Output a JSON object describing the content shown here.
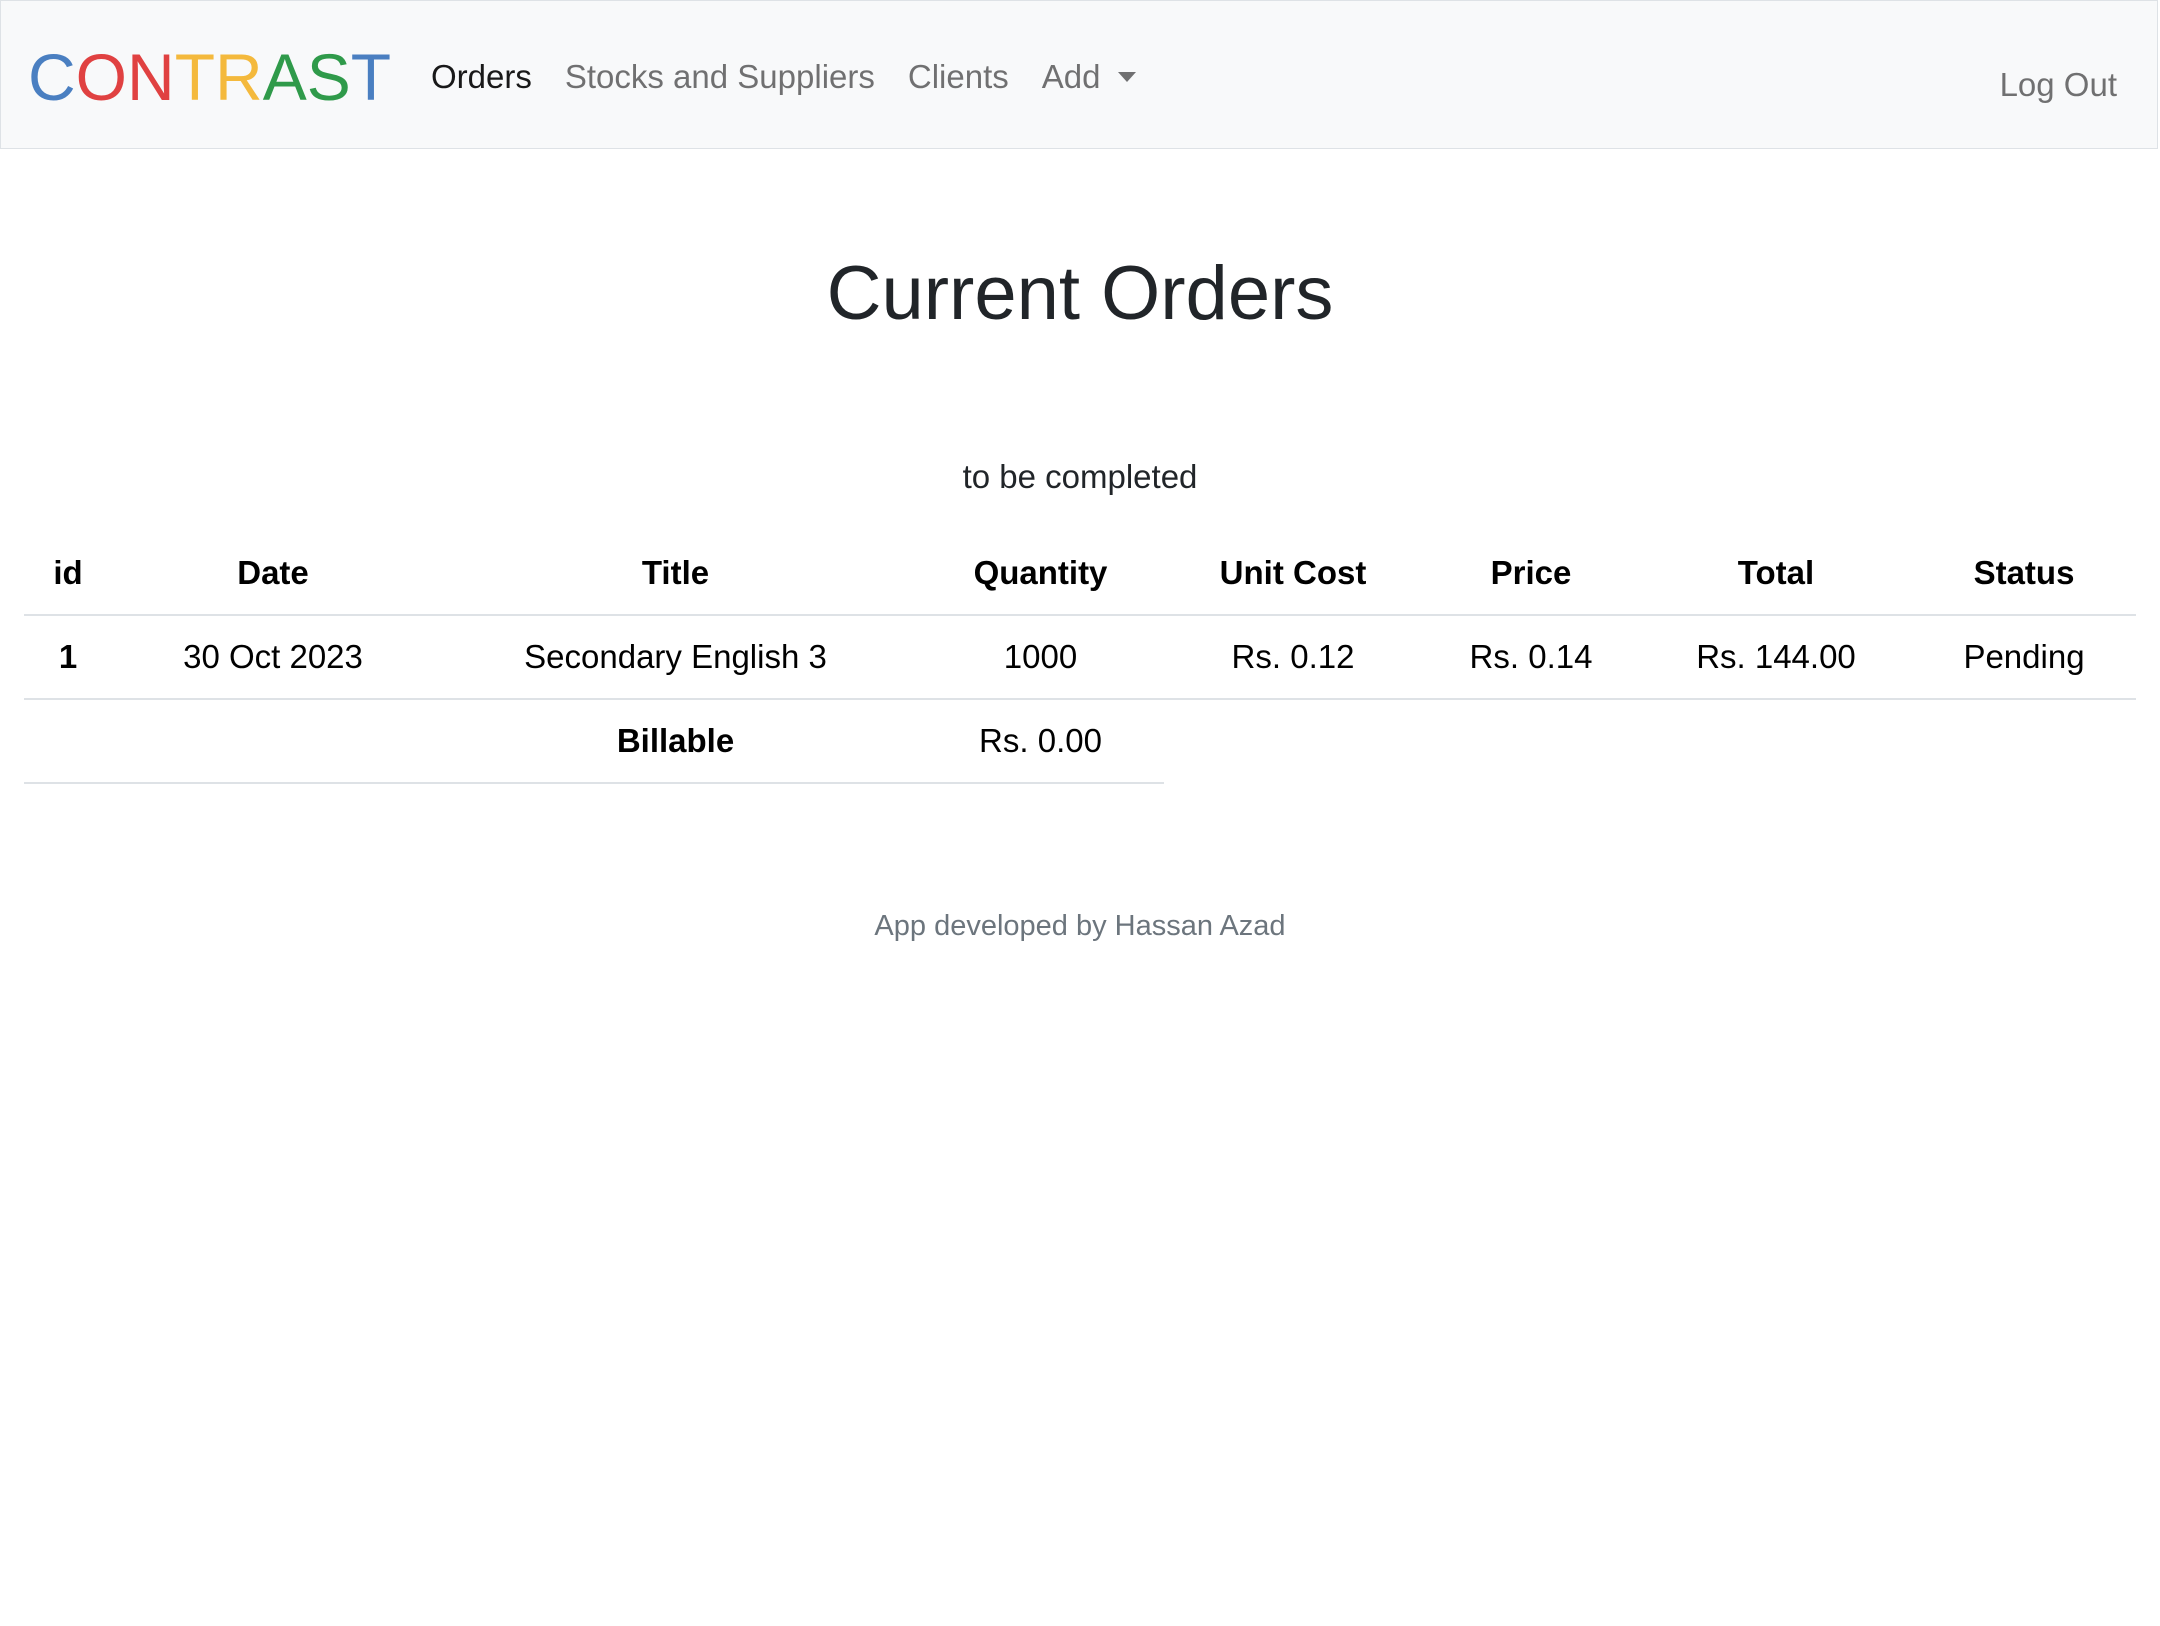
{
  "brand": {
    "letters": [
      {
        "char": "C",
        "color": "#4a7fc1"
      },
      {
        "char": "O",
        "color": "#e04141"
      },
      {
        "char": "N",
        "color": "#e04141"
      },
      {
        "char": "T",
        "color": "#f4b93c"
      },
      {
        "char": "R",
        "color": "#f4b93c"
      },
      {
        "char": "A",
        "color": "#2f9a4a"
      },
      {
        "char": "S",
        "color": "#2f9a4a"
      },
      {
        "char": "T",
        "color": "#4a7fc1"
      }
    ]
  },
  "nav": {
    "orders": "Orders",
    "stocks": "Stocks and Suppliers",
    "clients": "Clients",
    "add": "Add",
    "logout": "Log Out"
  },
  "main": {
    "title": "Current Orders",
    "subtitle": "to be completed"
  },
  "table": {
    "headers": [
      "id",
      "Date",
      "Title",
      "Quantity",
      "Unit Cost",
      "Price",
      "Total",
      "Status"
    ],
    "rows": [
      {
        "id": "1",
        "date": "30 Oct 2023",
        "title": "Secondary English 3",
        "quantity": "1000",
        "unit_cost": "Rs. 0.12",
        "price": "Rs. 0.14",
        "total": "Rs. 144.00",
        "status": "Pending"
      }
    ],
    "billable_label": "Billable",
    "billable_value": "Rs. 0.00"
  },
  "footer": {
    "credit": "App developed by Hassan Azad"
  }
}
